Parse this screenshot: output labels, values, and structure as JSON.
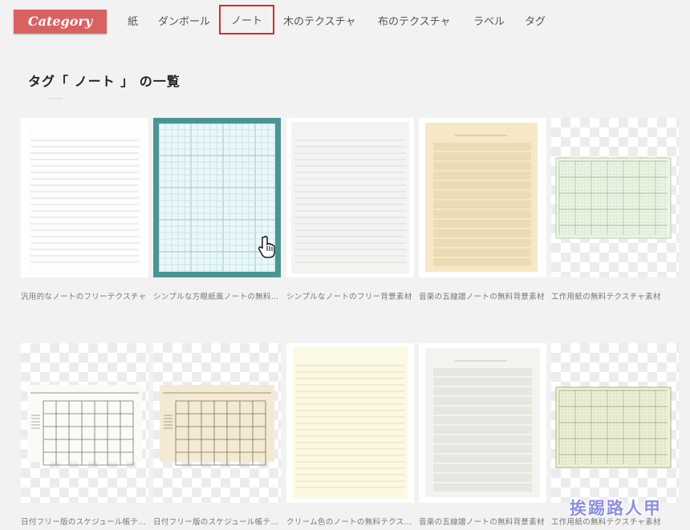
{
  "nav": {
    "logo": "Category",
    "items": [
      "紙",
      "ダンボール",
      "ノート",
      "木のテクスチャ",
      "布のテクスチャ",
      "ラベル",
      "タグ"
    ],
    "active": "ノート"
  },
  "page": {
    "title": "タグ「 ノート 」 の一覧"
  },
  "items": [
    {
      "caption": "汎用的なノートのフリーテクスチャ",
      "style": "lined-white"
    },
    {
      "caption": "シンプルな方眼紙風ノートの無料テクスチャ",
      "style": "grid-blue",
      "selected": true
    },
    {
      "caption": "シンプルなノートのフリー背景素材",
      "style": "lined-gray"
    },
    {
      "caption": "音楽の五線譜ノートの無料背景素材",
      "style": "staff-cream"
    },
    {
      "caption": "工作用紙の無料テクスチャ素材",
      "style": "graph-green"
    },
    {
      "caption": "日付フリー版のスケジュール帳テクスチャ",
      "style": "calendar-white"
    },
    {
      "caption": "日付フリー版のスケジュール帳テクスチャ",
      "style": "calendar-cream"
    },
    {
      "caption": "クリーム色のノートの無料テクスチャ",
      "style": "lined-yellow"
    },
    {
      "caption": "音楽の五線譜ノートの無料背景素材",
      "style": "staff-gray"
    },
    {
      "caption": "工作用紙の無料テクスチャ素材",
      "style": "graph-lightgreen"
    }
  ],
  "watermark": "挨踢路人甲",
  "colors": {
    "logo": "#d86262",
    "active_border": "#d92a2a",
    "selected_frame": "#4b9494"
  }
}
